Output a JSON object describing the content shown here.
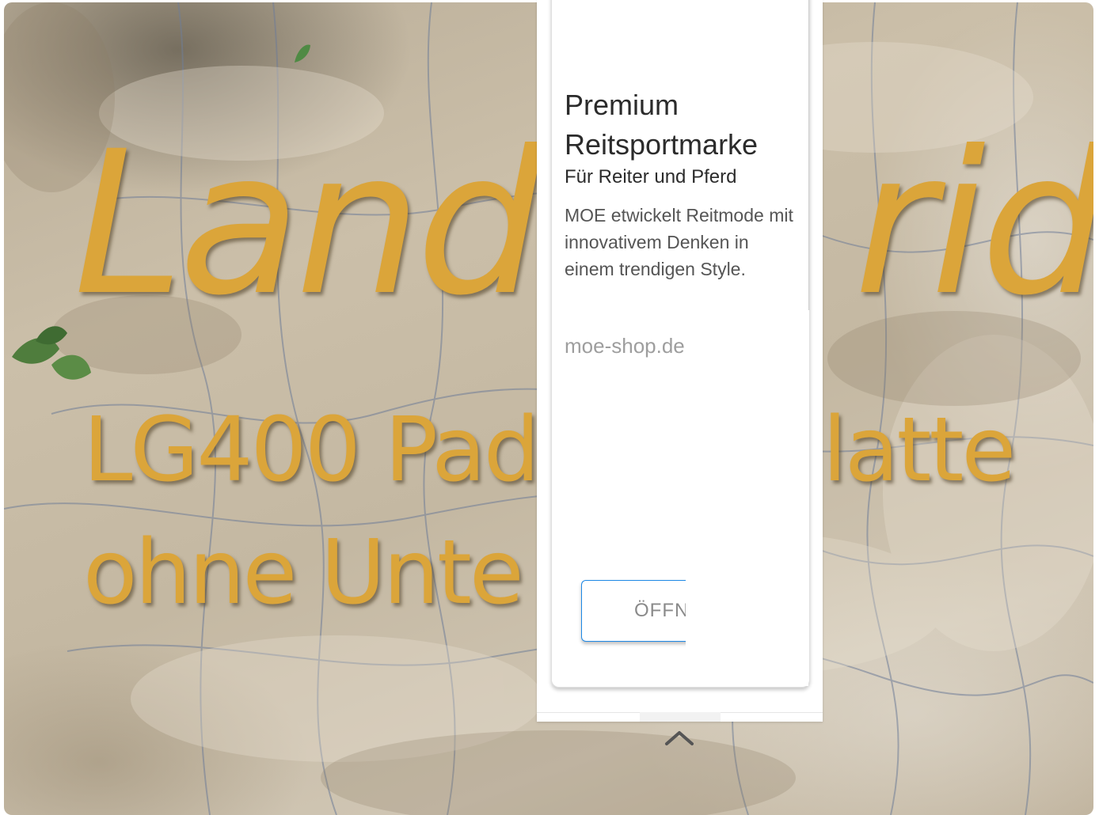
{
  "hero": {
    "title_left": "Land",
    "title_right": "rid",
    "subtitle_line1_left": "LG400 Pad",
    "subtitle_line1_right": "latte",
    "subtitle_line2_left": "ohne Unte",
    "accent_color": "#dba53a"
  },
  "card": {
    "title": "Premium Reitsportmarke",
    "subtitle": "Für Reiter und Pferd",
    "description": "MOE etwickelt Reitmode mit innovativem Denken in einem trendigen Style.",
    "link": "moe-shop.de",
    "open_button": "ÖFFNEN",
    "button_border_color": "#1e88e5"
  },
  "controls": {
    "collapse_icon": "chevron-up-icon"
  }
}
